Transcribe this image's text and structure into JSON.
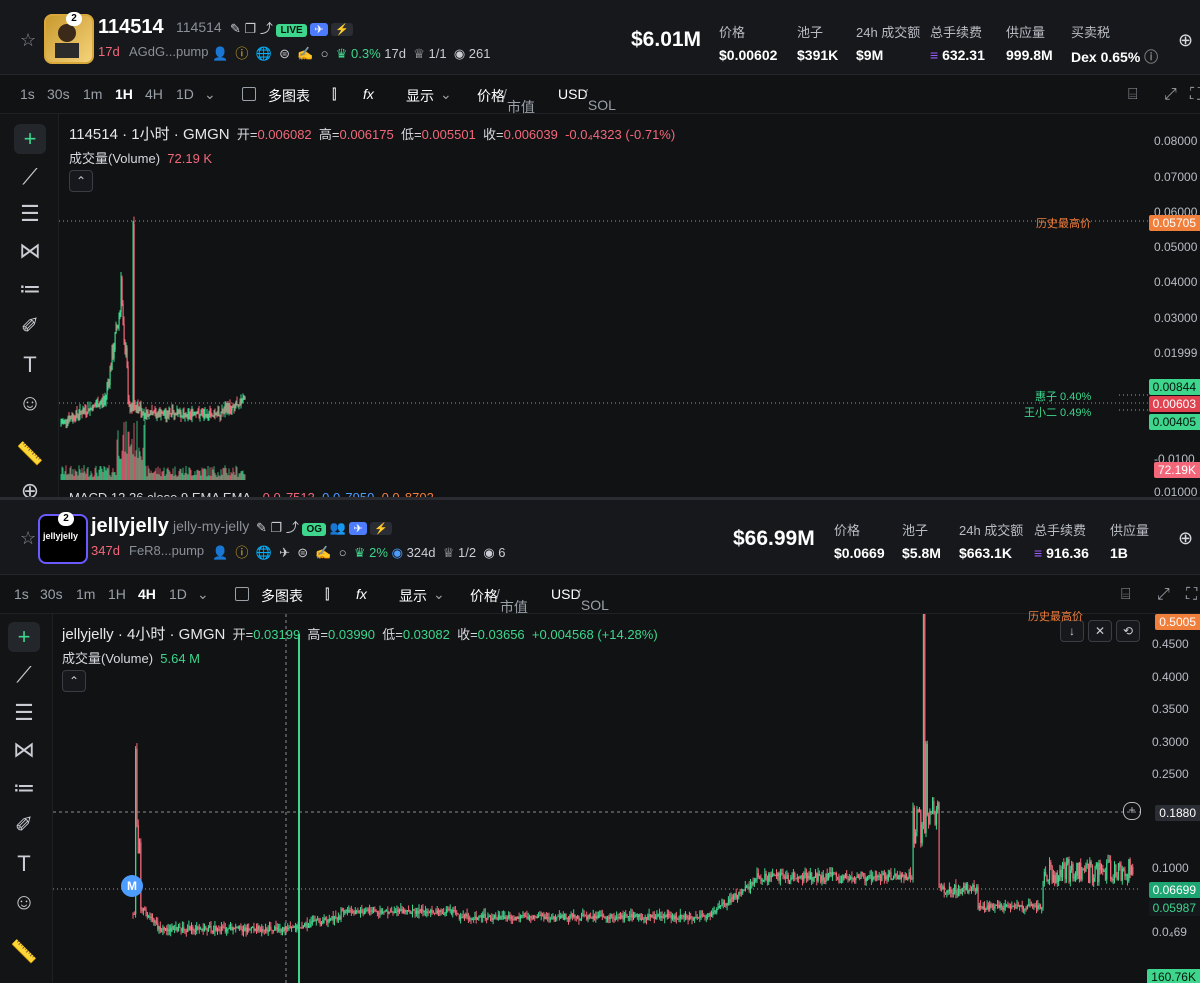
{
  "colors": {
    "up": "#3dd68c",
    "down": "#f2687a",
    "accent": "#4d7cff",
    "ath": "#f07f3c",
    "bg": "#111214"
  },
  "panel1": {
    "token_name": "114514",
    "token_sub": "114514",
    "age": "17d",
    "address": "AGdG...pump",
    "live_badge": "LIVE",
    "holder_pct": "0.3%",
    "holder_age": "17d",
    "ratio": "1/1",
    "views": "261",
    "market_cap": "$6.01M",
    "stats": [
      {
        "label": "价格",
        "value": "$0.00602"
      },
      {
        "label": "池子",
        "value": "$391K"
      },
      {
        "label": "24h 成交额",
        "value": "$9M"
      },
      {
        "label": "总手续费",
        "value": "632.31"
      },
      {
        "label": "供应量",
        "value": "999.8M"
      },
      {
        "label": "买卖税",
        "value": "Dex 0.65%"
      }
    ],
    "toolbar": {
      "intervals": [
        "1s",
        "30s",
        "1m",
        "1H",
        "4H",
        "1D"
      ],
      "active_interval": "1H",
      "multi_chart": "多图表",
      "display": "显示",
      "price": "价格",
      "mcap": "市值",
      "usd": "USD",
      "sol": "SOL"
    },
    "legend": {
      "title": "114514 · 1小时 · GMGN",
      "open_label": "开=",
      "open": "0.006082",
      "high_label": "高=",
      "high": "0.006175",
      "low_label": "低=",
      "low": "0.005501",
      "close_label": "收=",
      "close": "0.006039",
      "change": "-0.0₄4323 (-0.71%)",
      "volume_label": "成交量(Volume)",
      "volume": "72.19 K"
    },
    "macd_text": "MACD 12 26 close 9 EMA EMA",
    "macd_vals": [
      "-0.0₅7513",
      "0.0₅7950",
      "0.0₅8702"
    ],
    "ath_label": "历史最高价",
    "marker_a": "惠子 0.40%",
    "marker_b": "王小二 0.49%",
    "y_ticks": [
      "0.08000",
      "0.07000",
      "0.06000",
      "0.05000",
      "0.04000",
      "0.03000",
      "0.01999",
      "0.01000",
      "-0.0100"
    ],
    "tags": [
      "0.05705",
      "0.00844",
      "0.00603",
      "0.00405",
      "72.19K"
    ]
  },
  "panel2": {
    "token_name": "jellyjelly",
    "token_sub": "jelly-my-jelly",
    "age": "347d",
    "address": "FeR8...pump",
    "og_badge": "OG",
    "holder_pct": "2%",
    "holder_age": "324d",
    "ratio": "1/2",
    "views": "6",
    "market_cap": "$66.99M",
    "stats": [
      {
        "label": "价格",
        "value": "$0.0669"
      },
      {
        "label": "池子",
        "value": "$5.8M"
      },
      {
        "label": "24h 成交额",
        "value": "$663.1K"
      },
      {
        "label": "总手续费",
        "value": "916.36"
      },
      {
        "label": "供应量",
        "value": "1B"
      }
    ],
    "toolbar": {
      "intervals": [
        "1s",
        "30s",
        "1m",
        "1H",
        "4H",
        "1D"
      ],
      "active_interval": "4H",
      "multi_chart": "多图表",
      "display": "显示",
      "price": "价格",
      "mcap": "市值",
      "usd": "USD",
      "sol": "SOL"
    },
    "legend": {
      "title": "jellyjelly · 4小时 · GMGN",
      "open_label": "开=",
      "open": "0.03199",
      "high_label": "高=",
      "high": "0.03990",
      "low_label": "低=",
      "low": "0.03082",
      "close_label": "收=",
      "close": "0.03656",
      "change": "+0.004568 (+14.28%)",
      "volume_label": "成交量(Volume)",
      "volume": "5.64 M"
    },
    "ath_label": "历史最高价",
    "m_marker": "M",
    "y_ticks": [
      "0.4500",
      "0.4000",
      "0.3500",
      "0.3000",
      "0.2500",
      "0.1000",
      "0.0₄69"
    ],
    "tags": [
      "0.5005",
      "0.1880",
      "0.06699",
      "0.05987",
      "160.76K"
    ]
  }
}
